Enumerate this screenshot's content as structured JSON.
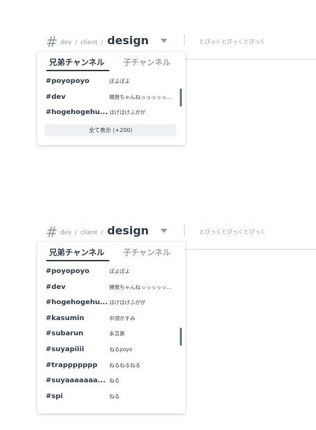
{
  "top": {
    "hash": "#",
    "crumb_1": "dev",
    "crumb_2": "client",
    "sep": "/",
    "channel": "design",
    "topic": "とぴっくとぴっくとぴっく",
    "tabs": {
      "siblings": "兄弟チャンネル",
      "children": "子チャンネル"
    },
    "rows": [
      {
        "name": "#poyopoyo",
        "desc": "ぽよぽよ"
      },
      {
        "name": "#dev",
        "desc": "開発ちゃんねっっっっっ..."
      },
      {
        "name": "#hogehogehu...",
        "desc": "ほげほげふがが"
      }
    ],
    "show_all": "全て表示 (+200)"
  },
  "bottom": {
    "hash": "#",
    "crumb_1": "dev",
    "crumb_2": "client",
    "sep": "/",
    "channel": "design",
    "topic": "とぴっくとぴっくとぴっく",
    "tabs": {
      "siblings": "兄弟チャンネル",
      "children": "子チャンネル"
    },
    "rows": [
      {
        "name": "#poyopoyo",
        "desc": "ぽよぽよ"
      },
      {
        "name": "#dev",
        "desc": "開発ちゃんねっっっっっ..."
      },
      {
        "name": "#hogehogehu...",
        "desc": "ほげほげふがが"
      },
      {
        "name": "#kasumin",
        "desc": "中須かすみ"
      },
      {
        "name": "#subarun",
        "desc": "永吉昴"
      },
      {
        "name": "#suyapiiii",
        "desc": "ねるpoyo"
      },
      {
        "name": "#trappppppp",
        "desc": "ねるねるねる"
      },
      {
        "name": "#suyaaaaaaa...",
        "desc": "ねる"
      },
      {
        "name": "#spi",
        "desc": "ねる"
      }
    ]
  }
}
